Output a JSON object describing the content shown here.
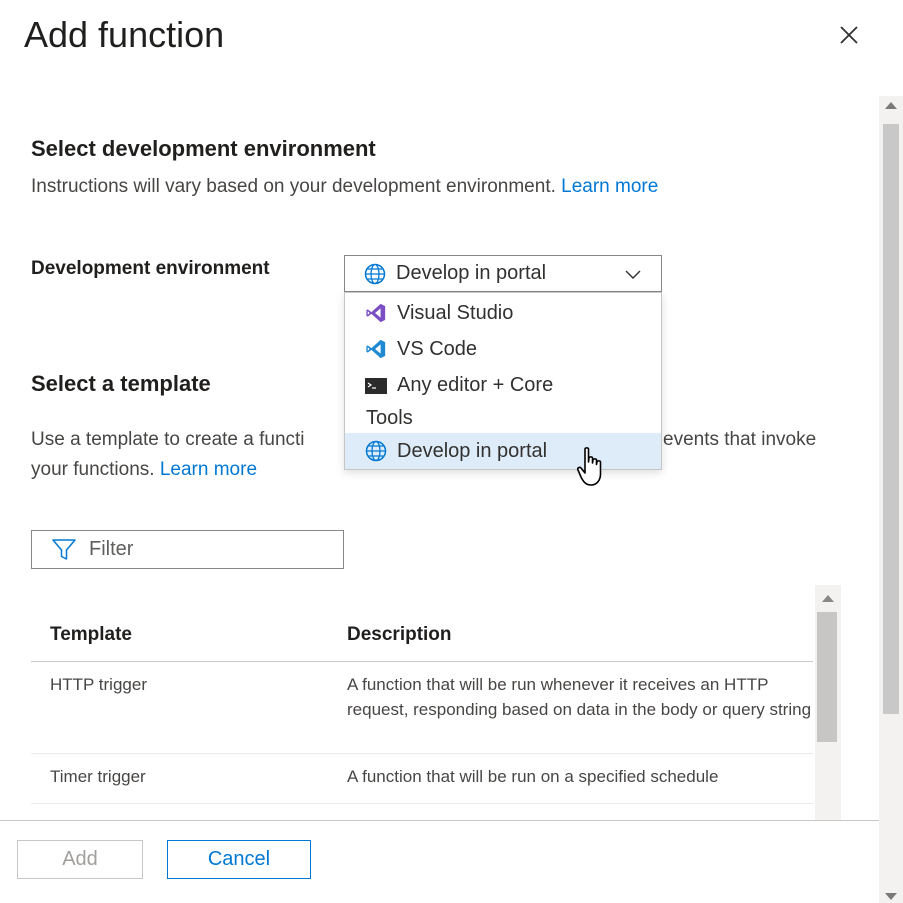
{
  "header": {
    "title": "Add function"
  },
  "dev_section": {
    "heading": "Select development environment",
    "description": "Instructions will vary based on your development environment.",
    "learn_more": "Learn more",
    "env_label": "Development environment",
    "selected": "Develop in portal",
    "options": [
      {
        "label": "Visual Studio",
        "icon": "visual-studio-icon"
      },
      {
        "label": "VS Code",
        "icon": "vs-code-icon"
      },
      {
        "label_line1": "Any editor + Core",
        "label_line2": "Tools",
        "icon": "terminal-icon"
      },
      {
        "label": "Develop in portal",
        "icon": "globe-icon"
      }
    ]
  },
  "template_section": {
    "heading": "Select a template",
    "description_part1": "Use a template to create a functi",
    "description_part2": "events that invoke",
    "description_line2": "your functions.",
    "learn_more": "Learn more",
    "filter_placeholder": "Filter",
    "columns": [
      "Template",
      "Description"
    ],
    "rows": [
      {
        "template": "HTTP trigger",
        "description": "A function that will be run whenever it receives an HTTP request, responding based on data in the body or query string"
      },
      {
        "template": "Timer trigger",
        "description": "A function that will be run on a specified schedule"
      }
    ]
  },
  "footer": {
    "add_label": "Add",
    "cancel_label": "Cancel"
  },
  "colors": {
    "accent": "#0078d4",
    "selected_bg": "#deecf9",
    "border": "#8a8886"
  }
}
